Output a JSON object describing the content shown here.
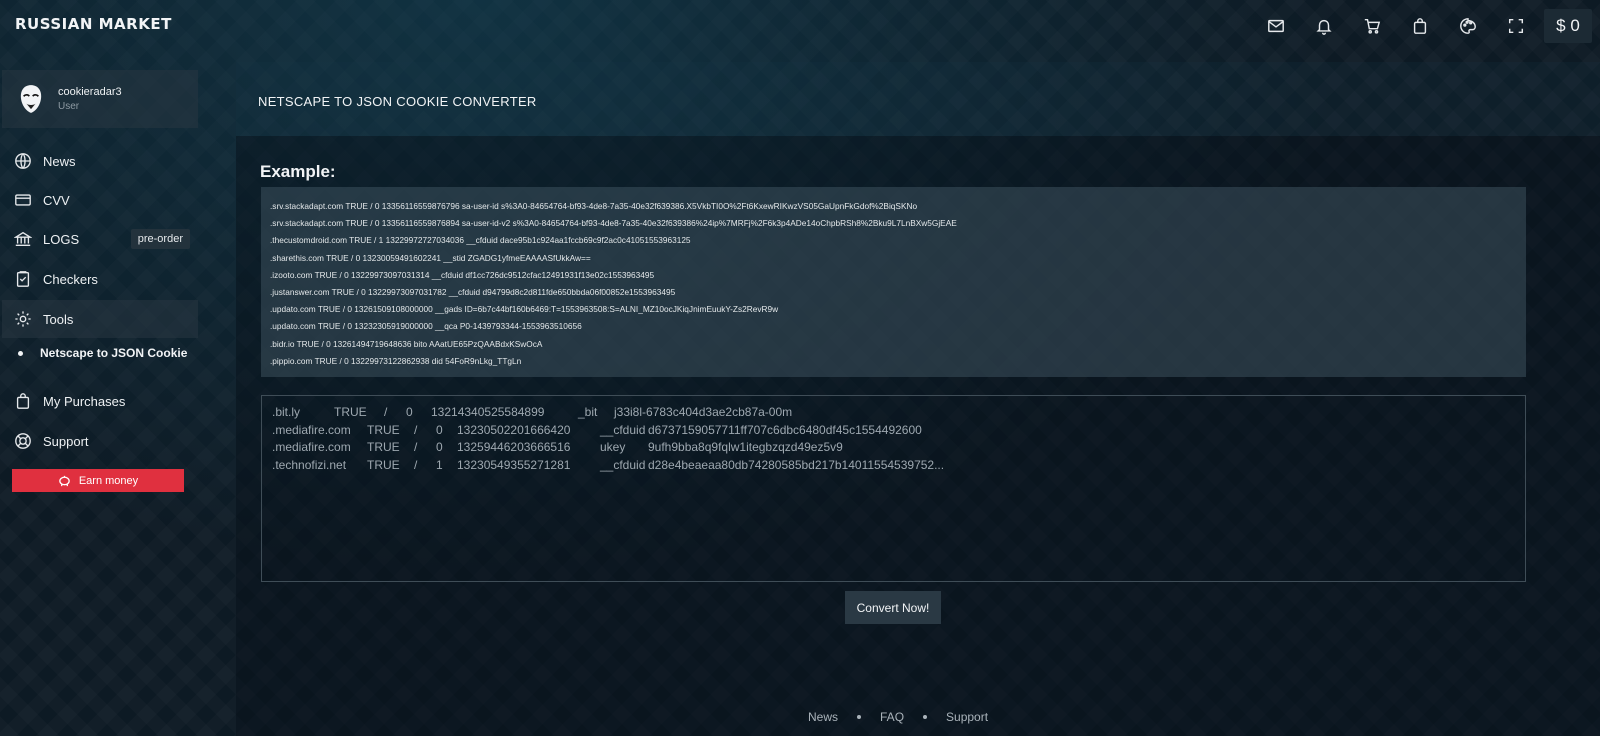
{
  "header": {
    "logo": "RUSSIAN MARKET",
    "balance": "$ 0",
    "icons": [
      "mail-icon",
      "bell-icon",
      "cart-icon",
      "bag-icon",
      "palette-icon",
      "fullscreen-icon"
    ]
  },
  "user": {
    "name": "cookieradar3",
    "role": "User"
  },
  "sidebar": {
    "items": [
      {
        "label": "News",
        "icon": "globe-icon"
      },
      {
        "label": "CVV",
        "icon": "card-icon"
      },
      {
        "label": "LOGS",
        "icon": "bank-icon",
        "badge": "pre-order"
      },
      {
        "label": "Checkers",
        "icon": "checklist-icon"
      },
      {
        "label": "Tools",
        "icon": "gear-icon"
      },
      {
        "label": "My Purchases",
        "icon": "bag-icon"
      },
      {
        "label": "Support",
        "icon": "lifebuoy-icon"
      }
    ],
    "sub_item": "Netscape to JSON Cookie",
    "earn_button": "Earn money"
  },
  "main": {
    "page_title": "NETSCAPE TO JSON COOKIE CONVERTER",
    "example_title": "Example:",
    "example_lines": [
      ".srv.stackadapt.com TRUE / 0 13356116559876796 sa-user-id s%3A0-84654764-bf93-4de8-7a35-40e32f639386.X5VkbTI0O%2Ft6KxewRIKwzVS05GaUpnFkGdof%2BiqSKNo",
      ".srv.stackadapt.com TRUE / 0 13356116559876894 sa-user-id-v2 s%3A0-84654764-bf93-4de8-7a35-40e32f639386%24ip%7MRFj%2F6k3p4ADe14oChpbRSh8%2Bku9L7LnBXw5GjEAE",
      ".thecustomdroid.com TRUE / 1 13229972727034036 __cfduid dace95b1c924aa1fccb69c9f2ac0c41051553963125",
      ".sharethis.com TRUE / 0 13230059491602241 __stid ZGADG1yfmeEAAAASfUkkAw==",
      ".izooto.com TRUE / 0 13229973097031314 __cfduid df1cc726dc9512cfac12491931f13e02c1553963495",
      ".justanswer.com TRUE / 0 13229973097031782 __cfduid d94799d8c2d811fde650bbda06f00852e1553963495",
      ".updato.com TRUE / 0 13261509108000000 __gads ID=6b7c44bf160b6469:T=1553963508:S=ALNI_MZ10ocJKiqJnimEuukY-Zs2RevR9w",
      ".updato.com TRUE / 0 13232305919000000 __qca P0-1439793344-1553963510656",
      ".bidr.io TRUE / 0 13261494719648636 bito AAatUE65PzQAABdxKSwOcA",
      ".pippio.com TRUE / 0 13229973122862938 did 54FoR9nLkg_TTgLn"
    ],
    "input_lines": [
      [
        ".bit.ly",
        "TRUE",
        "/",
        "0",
        "13214340525584899",
        "_bit",
        "j33i8l-6783c404d3ae2cb87a-00m"
      ],
      [
        ".mediafire.com",
        "TRUE",
        "/",
        "0",
        "13230502201666420",
        "__cfduid",
        "d6737159057711ff707c6dbc6480df45c1554492600"
      ],
      [
        ".mediafire.com",
        "TRUE",
        "/",
        "0",
        "13259446203666516",
        "ukey",
        "9ufh9bba8q9fqlw1itegbzqzd49ez5v9"
      ],
      [
        ".technofizi.net",
        "TRUE",
        "/",
        "1",
        "13230549355271281",
        "__cfduid",
        "d28e4beaeaa80db74280585bd217b14011554539752..."
      ]
    ],
    "convert_button": "Convert Now!"
  },
  "footer": {
    "links": [
      "News",
      "FAQ",
      "Support"
    ]
  }
}
